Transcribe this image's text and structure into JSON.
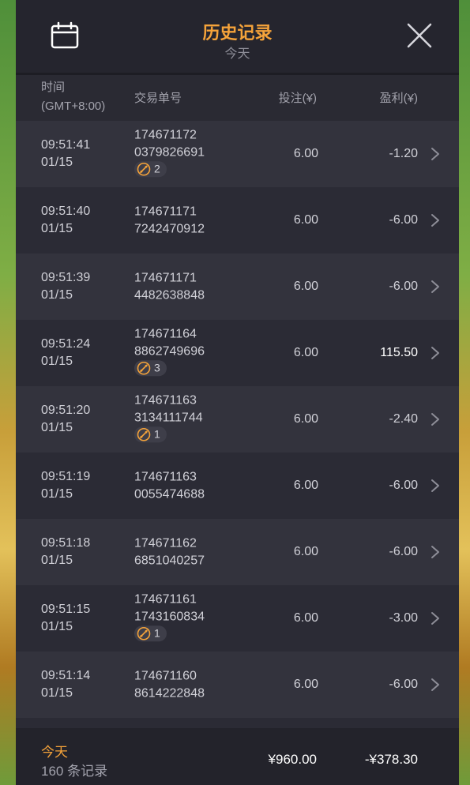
{
  "header": {
    "title": "历史记录",
    "subtitle": "今天"
  },
  "columns": {
    "time": "时间",
    "timezone": "(GMT+8:00)",
    "order_id": "交易单号",
    "bet": "投注(¥)",
    "profit": "盈利(¥)"
  },
  "rows": [
    {
      "time": "09:51:41",
      "date": "01/15",
      "id_line1": "174671172",
      "id_line2": "0379826691",
      "badge": "2",
      "bet": "6.00",
      "profit": "-1.20"
    },
    {
      "time": "09:51:40",
      "date": "01/15",
      "id_line1": "174671171",
      "id_line2": "7242470912",
      "badge": "",
      "bet": "6.00",
      "profit": "-6.00"
    },
    {
      "time": "09:51:39",
      "date": "01/15",
      "id_line1": "174671171",
      "id_line2": "4482638848",
      "badge": "",
      "bet": "6.00",
      "profit": "-6.00"
    },
    {
      "time": "09:51:24",
      "date": "01/15",
      "id_line1": "174671164",
      "id_line2": "8862749696",
      "badge": "3",
      "bet": "6.00",
      "profit": "115.50"
    },
    {
      "time": "09:51:20",
      "date": "01/15",
      "id_line1": "174671163",
      "id_line2": "3134111744",
      "badge": "1",
      "bet": "6.00",
      "profit": "-2.40"
    },
    {
      "time": "09:51:19",
      "date": "01/15",
      "id_line1": "174671163",
      "id_line2": "0055474688",
      "badge": "",
      "bet": "6.00",
      "profit": "-6.00"
    },
    {
      "time": "09:51:18",
      "date": "01/15",
      "id_line1": "174671162",
      "id_line2": "6851040257",
      "badge": "",
      "bet": "6.00",
      "profit": "-6.00"
    },
    {
      "time": "09:51:15",
      "date": "01/15",
      "id_line1": "174671161",
      "id_line2": "1743160834",
      "badge": "1",
      "bet": "6.00",
      "profit": "-3.00"
    },
    {
      "time": "09:51:14",
      "date": "01/15",
      "id_line1": "174671160",
      "id_line2": "8614222848",
      "badge": "",
      "bet": "6.00",
      "profit": "-6.00"
    }
  ],
  "footer": {
    "period": "今天",
    "count": "160 条记录",
    "total_bet": "¥960.00",
    "total_profit": "-¥378.30"
  },
  "icons": {
    "calendar": "calendar-icon",
    "close": "close-icon",
    "chevron": "chevron-right-icon",
    "badge": "free-spin-icon"
  },
  "colors": {
    "accent": "#f5a33a",
    "panel": "#2b2b35",
    "row_alt": "#33333d"
  }
}
